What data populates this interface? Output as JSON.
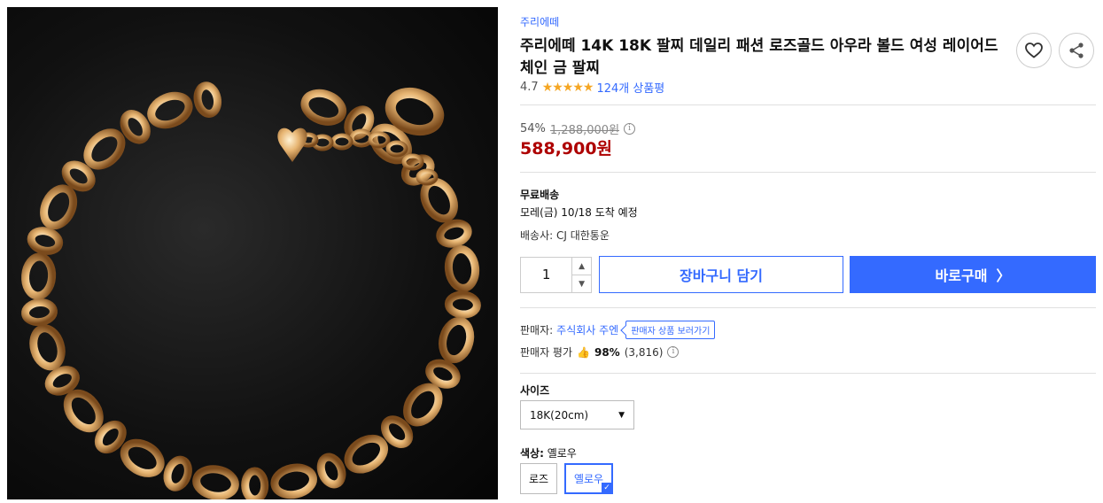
{
  "product": {
    "brand": "주리에떼",
    "title": "주리에떼 14K 18K 팔찌 데일리 패션 로즈골드 아우라 볼드 여성 레이어드 체인 금 팔찌",
    "rating": "4.7",
    "stars": "★★★★★",
    "review_count": "124개 상품평"
  },
  "price": {
    "discount": "54%",
    "original": "1,288,000원",
    "info_glyph": "i",
    "sale": "588,900원"
  },
  "shipping": {
    "title": "무료배송",
    "arrival": "모레(금) 10/18 도착 예정",
    "carrier": "배송사: CJ 대한통운"
  },
  "purchase": {
    "quantity": "1",
    "qty_up": "▲",
    "qty_down": "▼",
    "cart_label": "장바구니 담기",
    "buy_label": "바로구매",
    "buy_chevron": "〉"
  },
  "seller": {
    "label": "판매자:",
    "name": "주식회사 주엔",
    "products_link": "판매자 상품 보러가기",
    "rating_label": "판매자 평가",
    "thumb": "👍",
    "rating_pct": "98%",
    "rating_count": "(3,816)",
    "info_glyph": "i"
  },
  "options": {
    "size_label": "사이즈",
    "size_selected": "18K(20cm)",
    "size_caret": "▼",
    "color_label": "색상:",
    "color_selected": "옐로우",
    "colors": [
      "로즈",
      "옐로우"
    ],
    "check_glyph": "✓"
  },
  "icons": {
    "heart": "heart-icon",
    "share": "share-icon"
  },
  "colors": {
    "accent": "#346aff",
    "price_red": "#ae0000",
    "star": "#f5a623"
  }
}
